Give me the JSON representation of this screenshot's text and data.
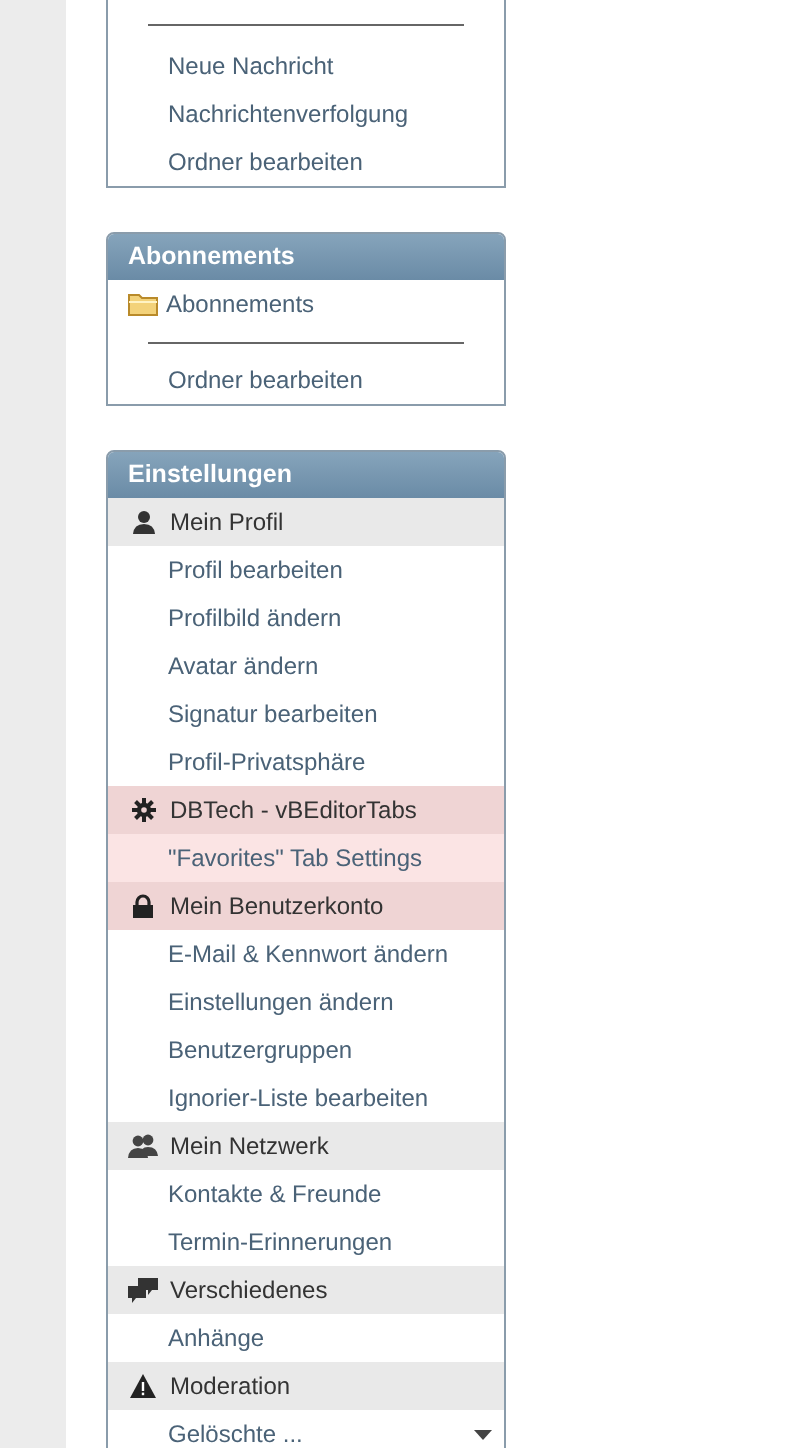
{
  "panels": [
    {
      "rows": [
        {
          "kind": "divider"
        },
        {
          "kind": "link",
          "label": "Neue Nachricht"
        },
        {
          "kind": "link",
          "label": "Nachrichtenverfolgung"
        },
        {
          "kind": "link",
          "label": "Ordner bearbeiten"
        }
      ]
    },
    {
      "title": "Abonnements",
      "rows": [
        {
          "kind": "folder",
          "label": "Abonnements"
        },
        {
          "kind": "divider"
        },
        {
          "kind": "link",
          "label": "Ordner bearbeiten"
        }
      ]
    },
    {
      "title": "Einstellungen",
      "rows": [
        {
          "kind": "section",
          "label": "Mein Profil",
          "highlighted": false
        },
        {
          "kind": "link",
          "label": "Profil bearbeiten",
          "highlighted": false
        },
        {
          "kind": "link",
          "label": "Profilbild ändern",
          "highlighted": false
        },
        {
          "kind": "link",
          "label": "Avatar ändern",
          "highlighted": false
        },
        {
          "kind": "link",
          "label": "Signatur bearbeiten",
          "highlighted": false
        },
        {
          "kind": "link",
          "label": "Profil-Privatsphäre",
          "highlighted": false
        },
        {
          "kind": "section",
          "label": "DBTech - vBEditorTabs",
          "highlighted": true
        },
        {
          "kind": "link",
          "label": "\"Favorites\" Tab Settings",
          "highlighted": true
        },
        {
          "kind": "section",
          "label": "Mein Benutzerkonto",
          "highlighted": true
        },
        {
          "kind": "link",
          "label": "E-Mail & Kennwort ändern",
          "highlighted": false
        },
        {
          "kind": "link",
          "label": "Einstellungen ändern",
          "highlighted": false
        },
        {
          "kind": "link",
          "label": "Benutzergruppen",
          "highlighted": false
        },
        {
          "kind": "link",
          "label": "Ignorier-Liste bearbeiten",
          "highlighted": false
        },
        {
          "kind": "section",
          "label": "Mein Netzwerk",
          "highlighted": false
        },
        {
          "kind": "link",
          "label": "Kontakte & Freunde",
          "highlighted": false
        },
        {
          "kind": "link",
          "label": "Termin-Erinnerungen",
          "highlighted": false
        },
        {
          "kind": "section",
          "label": "Verschiedenes",
          "highlighted": false
        },
        {
          "kind": "link",
          "label": "Anhänge",
          "highlighted": false
        },
        {
          "kind": "section",
          "label": "Moderation",
          "highlighted": false
        },
        {
          "kind": "dropdown",
          "label": "Gelöschte ...",
          "highlighted": false
        }
      ]
    }
  ]
}
